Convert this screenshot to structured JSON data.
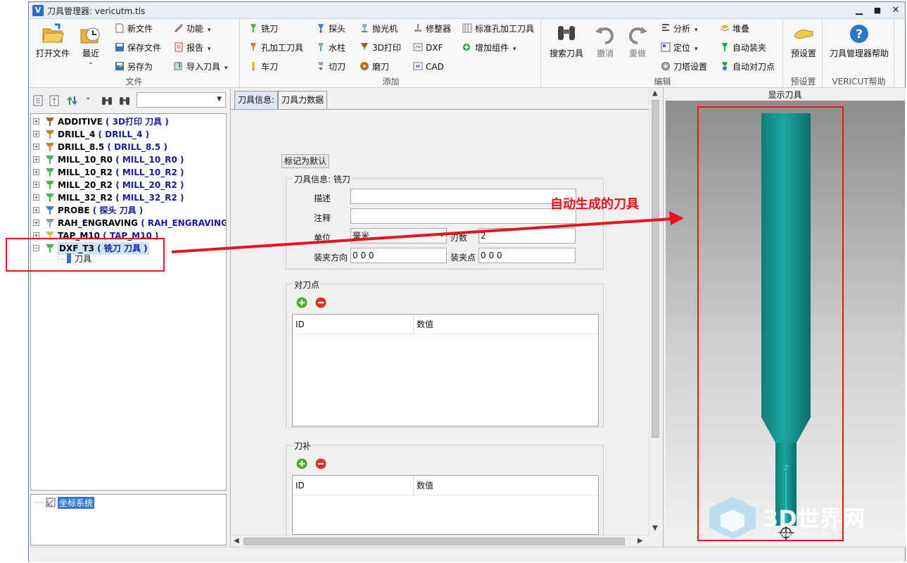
{
  "window": {
    "title": "刀具管理器: vericutm.tls",
    "minimize": "▁",
    "maximize": "■",
    "close": "✕"
  },
  "ribbon": {
    "file": {
      "label": "文件",
      "open": "打开文件",
      "recent": "最近",
      "new": "新文件",
      "save": "保存文件",
      "saveas": "另存为",
      "function": "功能",
      "report": "报告",
      "import": "导入刀具"
    },
    "add": {
      "label": "添加",
      "mill": "铣刀",
      "hole": "孔加工刀具",
      "lathe": "车刀",
      "probe": "探头",
      "waterjet": "水柱",
      "cut": "切刀",
      "polisher": "抛光机",
      "print3d": "3D打印",
      "grind": "磨刀",
      "dresser": "修整器",
      "dxf": "DXF",
      "cad": "CAD",
      "std_hole": "标准孔加工刀具",
      "add_comp": "增加组件"
    },
    "edit": {
      "label": "编辑",
      "search": "搜索刀具",
      "undo": "撤消",
      "redo": "重做",
      "analyze": "分析",
      "locate": "定位",
      "turret": "刀塔设置",
      "stack": "堆叠",
      "auto_clamp": "自动装夹",
      "auto_touch": "自动对刀点"
    },
    "preset": {
      "label": "预设置",
      "btn": "预设置"
    },
    "help": {
      "label": "VERICUT帮助",
      "btn": "刀具管理器帮助"
    }
  },
  "tree": {
    "items": [
      {
        "name": "ADDITIVE",
        "sub": "( 3D打印 刀具 )",
        "icon_color": "#8a6d2b"
      },
      {
        "name": "DRILL_4",
        "sub": "( DRILL_4 )",
        "icon_color": "#c87f3c"
      },
      {
        "name": "DRILL_8.5",
        "sub": "( DRILL_8.5 )",
        "icon_color": "#c87f3c"
      },
      {
        "name": "MILL_10_R0",
        "sub": "( MILL_10_R0 )",
        "icon_color": "#49b849"
      },
      {
        "name": "MILL_10_R2",
        "sub": "( MILL_10_R2 )",
        "icon_color": "#49b849"
      },
      {
        "name": "MILL_20_R2",
        "sub": "( MILL_20_R2 )",
        "icon_color": "#49b849"
      },
      {
        "name": "MILL_32_R2",
        "sub": "( MILL_32_R2 )",
        "icon_color": "#49b849"
      },
      {
        "name": "PROBE",
        "sub": "( 探头 刀具 )",
        "icon_color": "#3f7fcf"
      },
      {
        "name": "RAH_ENGRAVING",
        "sub": "( RAH_ENGRAVING )",
        "icon_color": "#7fa0a8"
      },
      {
        "name": "TAP_M10",
        "sub": "( TAP_M10 )",
        "icon_color": "#d6c23a"
      },
      {
        "name": "DXF_T3",
        "sub": "( 铣刀 刀具 )",
        "icon_color": "#49b849"
      }
    ],
    "child": "刀具",
    "coord": "坐标系统"
  },
  "tabs": {
    "info": "刀具信息:",
    "force": "刀具力数据"
  },
  "form": {
    "mark_default": "标记为默认",
    "group_title": "刀具信息: 铣刀",
    "desc_label": "描述",
    "desc_value": "",
    "note_label": "注释",
    "note_value": "",
    "unit_label": "单位",
    "unit_value": "毫米",
    "teeth_label": "刃数",
    "teeth_value": "2",
    "clamp_dir_label": "装夹方向",
    "clamp_dir_value": "0 0 0",
    "clamp_pt_label": "装夹点",
    "clamp_pt_value": "0 0 0",
    "touch_title": "对刀点",
    "comp_title": "刀补",
    "col_id": "ID",
    "col_value": "数值"
  },
  "viewer": {
    "label": "显示刀具",
    "axis_z": "Z",
    "tool_color": "#14918e"
  },
  "annotation": {
    "text": "自动生成的刀具",
    "color": "#e6141b"
  },
  "watermark": {
    "title": "3D世界网",
    "url": "WWW.3DSJW.COM"
  }
}
